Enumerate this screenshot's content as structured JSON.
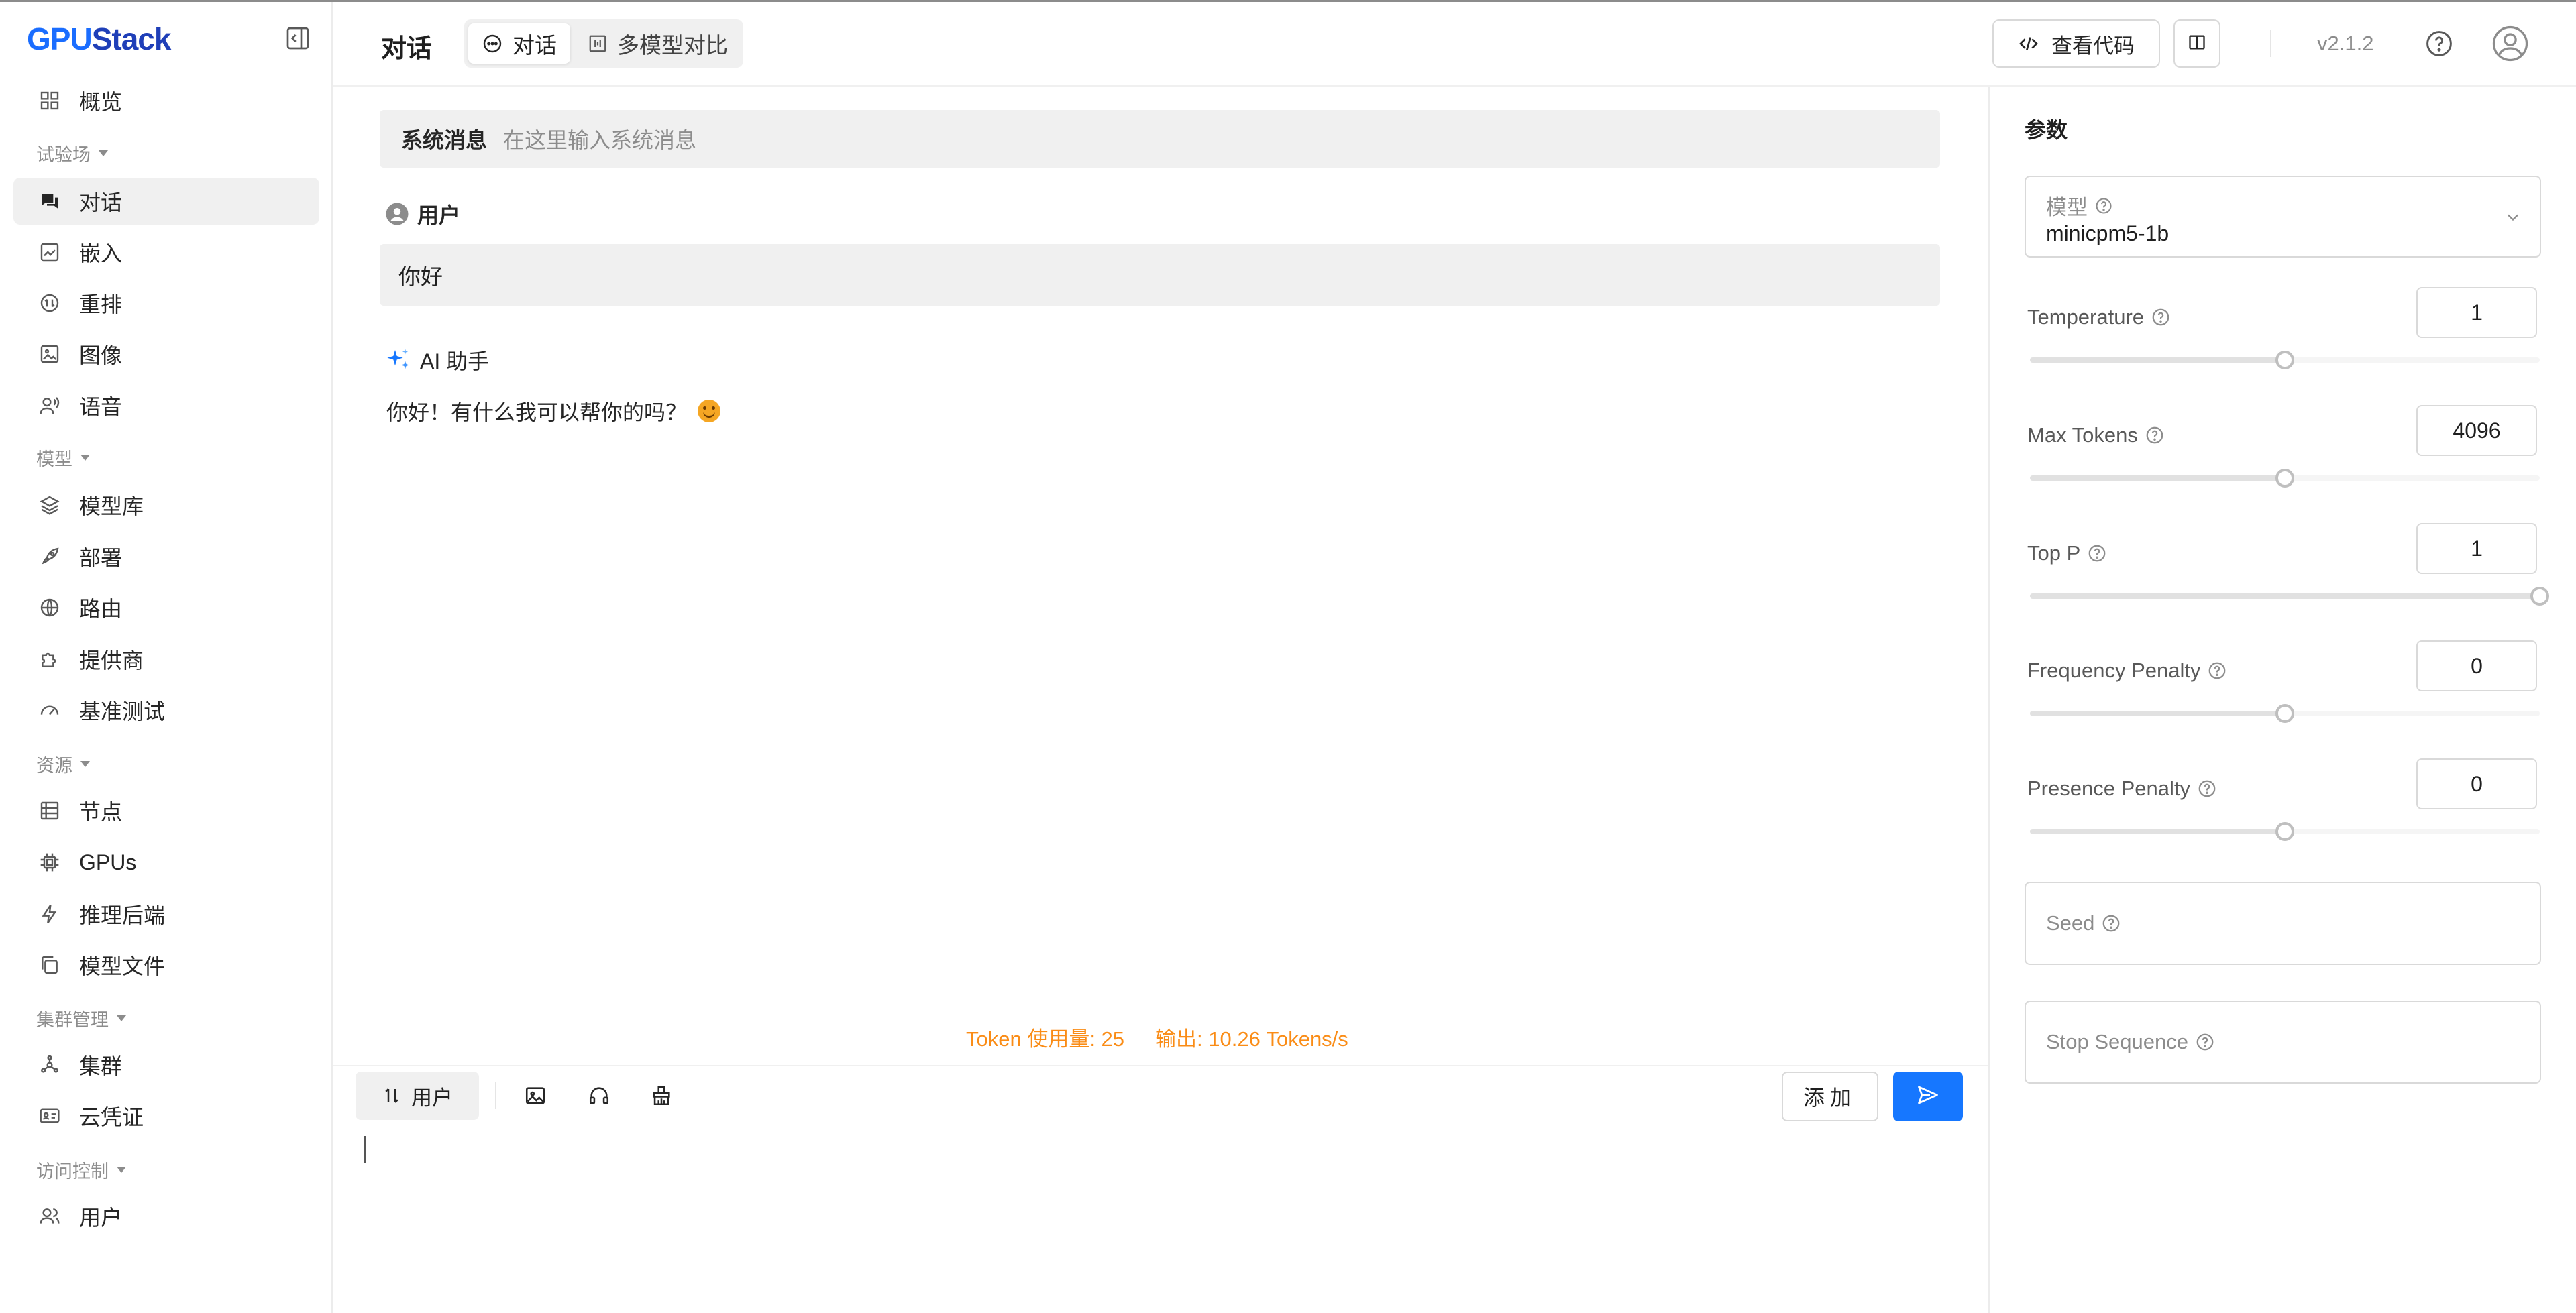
{
  "app": {
    "logo_text_1": "GPU",
    "logo_text_2": "Stack"
  },
  "sidebar": {
    "items": [
      {
        "label": "概览",
        "icon": "dashboard-icon"
      },
      {
        "label": "对话",
        "icon": "chat-icon",
        "active": true
      },
      {
        "label": "嵌入",
        "icon": "embedding-icon"
      },
      {
        "label": "重排",
        "icon": "rerank-icon"
      },
      {
        "label": "图像",
        "icon": "image-icon"
      },
      {
        "label": "语音",
        "icon": "voice-icon"
      },
      {
        "label": "模型库",
        "icon": "layers-icon"
      },
      {
        "label": "部署",
        "icon": "rocket-icon"
      },
      {
        "label": "路由",
        "icon": "globe-icon"
      },
      {
        "label": "提供商",
        "icon": "puzzle-icon"
      },
      {
        "label": "基准测试",
        "icon": "gauge-icon"
      },
      {
        "label": "节点",
        "icon": "server-icon"
      },
      {
        "label": "GPUs",
        "icon": "chip-icon"
      },
      {
        "label": "推理后端",
        "icon": "bolt-icon"
      },
      {
        "label": "模型文件",
        "icon": "files-icon"
      },
      {
        "label": "集群",
        "icon": "cluster-icon"
      },
      {
        "label": "云凭证",
        "icon": "id-card-icon"
      },
      {
        "label": "用户",
        "icon": "users-icon"
      }
    ],
    "groups": [
      "试验场",
      "模型",
      "资源",
      "集群管理",
      "访问控制"
    ]
  },
  "header": {
    "title": "对话",
    "tabs": [
      {
        "label": "对话"
      },
      {
        "label": "多模型对比"
      }
    ],
    "view_code_label": "查看代码",
    "version": "v2.1.2"
  },
  "chat": {
    "system_label": "系统消息",
    "system_placeholder": "在这里输入系统消息",
    "user_role": "用户",
    "user_message": "你好",
    "assistant_role": "AI 助手",
    "assistant_message": "你好！有什么我可以帮你的吗？",
    "token_usage": "Token 使用量: 25",
    "token_speed": "输出: 10.26 Tokens/s"
  },
  "composer": {
    "role_label": "用户",
    "add_label": "添加"
  },
  "params": {
    "title": "参数",
    "model_label": "模型",
    "model_value": "minicpm5-1b",
    "sliders": [
      {
        "label": "Temperature",
        "value": "1",
        "fraction": 0.5
      },
      {
        "label": "Max Tokens",
        "value": "4096",
        "fraction": 0.5
      },
      {
        "label": "Top P",
        "value": "1",
        "fraction": 1.0
      },
      {
        "label": "Frequency Penalty",
        "value": "0",
        "fraction": 0.5
      },
      {
        "label": "Presence Penalty",
        "value": "0",
        "fraction": 0.5
      }
    ],
    "seed_label": "Seed",
    "stop_label": "Stop Sequence"
  },
  "colors": {
    "accent": "#1677ff",
    "token_text": "#fa8c16"
  }
}
